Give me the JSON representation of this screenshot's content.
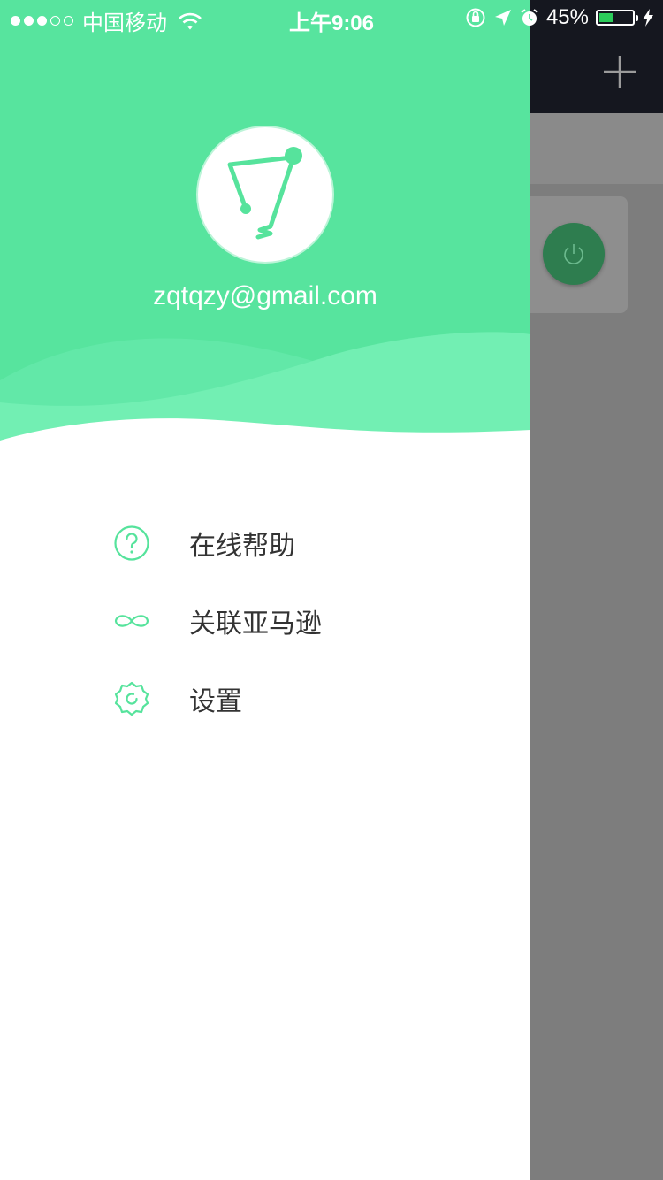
{
  "status_bar": {
    "carrier": "中国移动",
    "time": "上午9:06",
    "battery_percent": "45%",
    "battery_level": 0.45,
    "signal_dots": [
      true,
      true,
      true,
      false,
      false
    ]
  },
  "drawer": {
    "email": "zqtqzy@gmail.com",
    "menu": [
      {
        "label": "在线帮助",
        "icon": "help-circle-icon"
      },
      {
        "label": "关联亚马逊",
        "icon": "link-infinity-icon"
      },
      {
        "label": "设置",
        "icon": "gear-icon"
      }
    ]
  },
  "colors": {
    "accent": "#56e39c",
    "header_green": "#57e49e",
    "navbar_dark": "#15171f",
    "overlay_gray": "#7d7d7d",
    "power_green": "#2e7d4f",
    "menu_text": "#333333"
  }
}
